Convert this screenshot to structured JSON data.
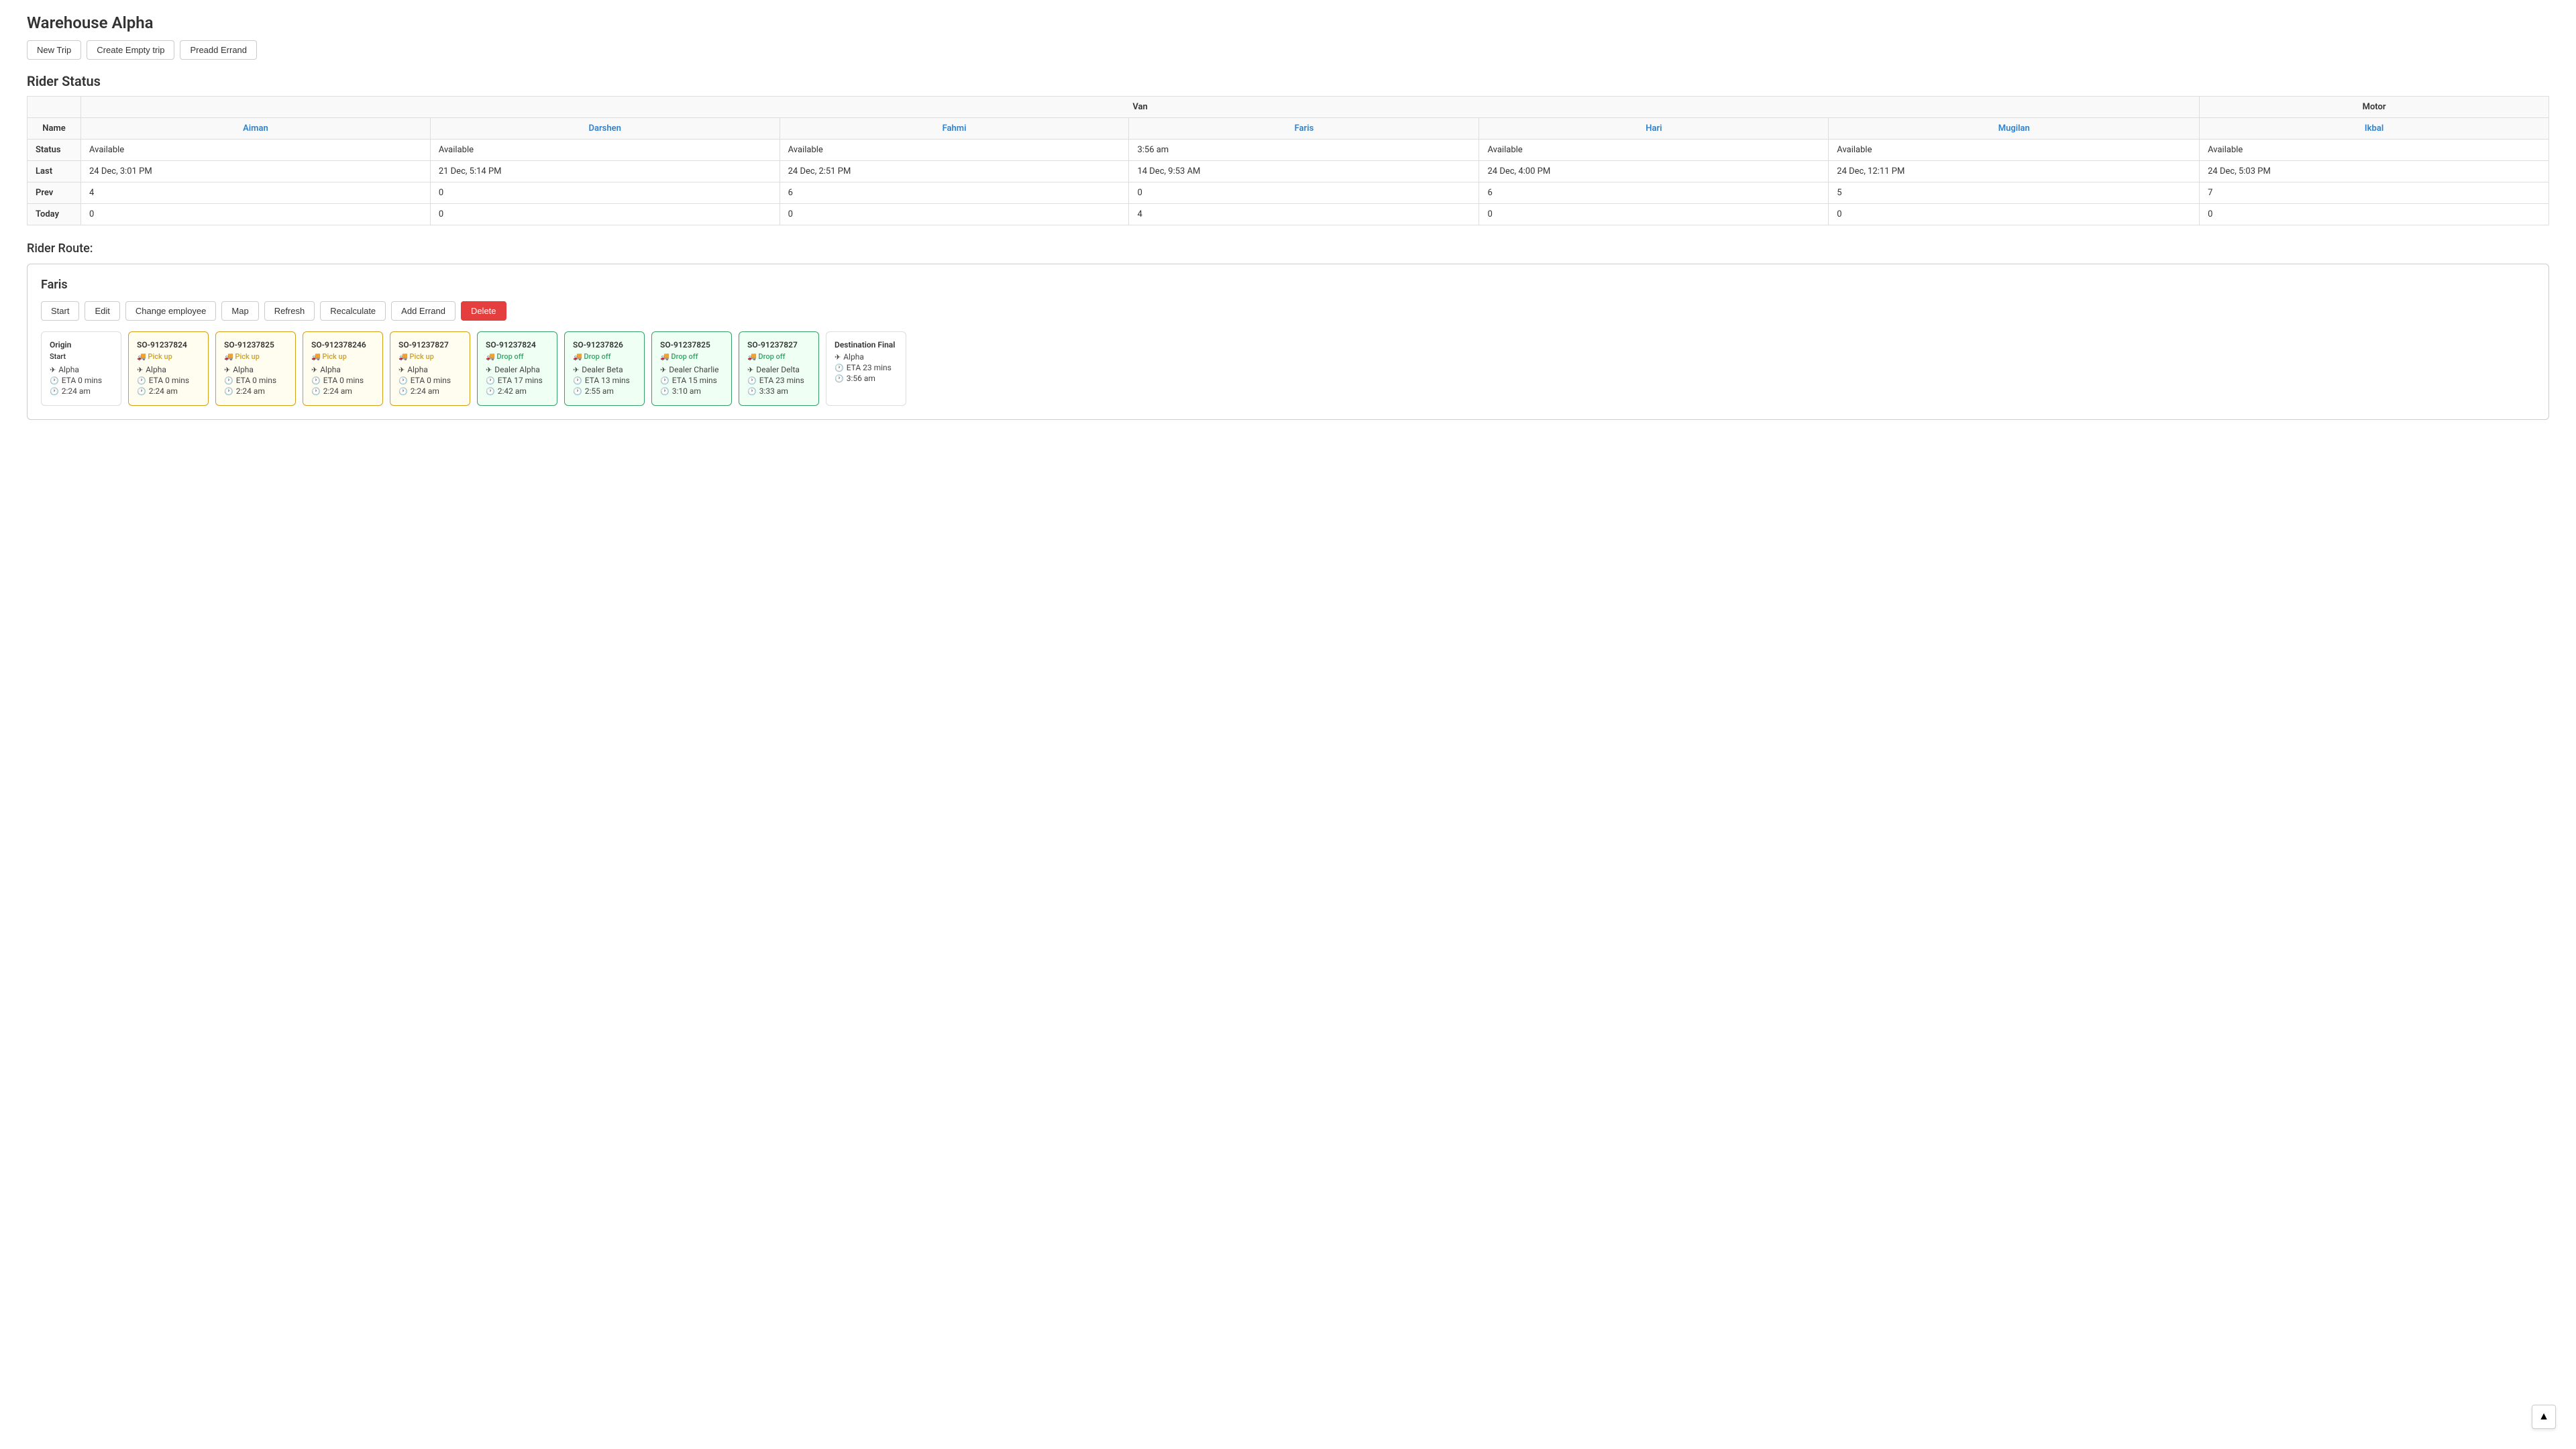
{
  "page": {
    "title": "Warehouse Alpha",
    "toolbar": {
      "new_trip": "New Trip",
      "create_empty_trip": "Create Empty trip",
      "preadd_errand": "Preadd Errand"
    }
  },
  "rider_status": {
    "section_title": "Rider Status",
    "column_groups": [
      {
        "label": "Van",
        "span": 6
      },
      {
        "label": "Motor",
        "span": 1
      }
    ],
    "riders": [
      "Aiman",
      "Darshen",
      "Fahmi",
      "Faris",
      "Hari",
      "Mugilan",
      "Ikbal"
    ],
    "rows": {
      "status": [
        "Available",
        "Available",
        "Available",
        "3:56 am",
        "Available",
        "Available",
        "Available"
      ],
      "last": [
        "24 Dec, 3:01 PM",
        "21 Dec, 5:14 PM",
        "24 Dec, 2:51 PM",
        "14 Dec, 9:53 AM",
        "24 Dec, 4:00 PM",
        "24 Dec, 12:11 PM",
        "24 Dec, 5:03 PM"
      ],
      "prev": [
        "4",
        "0",
        "6",
        "0",
        "6",
        "5",
        "7"
      ],
      "today": [
        "0",
        "0",
        "0",
        "4",
        "0",
        "0",
        "0"
      ]
    }
  },
  "rider_route": {
    "section_title": "Rider Route:",
    "rider_name": "Faris",
    "toolbar": {
      "start": "Start",
      "edit": "Edit",
      "change_employee": "Change employee",
      "map": "Map",
      "refresh": "Refresh",
      "recalculate": "Recalculate",
      "add_errand": "Add Errand",
      "delete": "Delete"
    },
    "cards": [
      {
        "id": "origin",
        "title": "Origin",
        "type": "Start",
        "type_class": "plain",
        "location": "Alpha",
        "eta_mins": "0 mins",
        "eta_time": "2:24 am",
        "border": "plain-border"
      },
      {
        "id": "so1",
        "title": "SO-91237824",
        "type": "🚚 Pick up",
        "type_class": "pickup",
        "location": "Alpha",
        "eta_mins": "0 mins",
        "eta_time": "2:24 am",
        "border": "yellow-border"
      },
      {
        "id": "so2",
        "title": "SO-91237825",
        "type": "🚚 Pick up",
        "type_class": "pickup",
        "location": "Alpha",
        "eta_mins": "0 mins",
        "eta_time": "2:24 am",
        "border": "yellow-border"
      },
      {
        "id": "so3",
        "title": "SO-912378246",
        "type": "🚚 Pick up",
        "type_class": "pickup",
        "location": "Alpha",
        "eta_mins": "0 mins",
        "eta_time": "2:24 am",
        "border": "yellow-border"
      },
      {
        "id": "so4",
        "title": "SO-91237827",
        "type": "🚚 Pick up",
        "type_class": "pickup",
        "location": "Alpha",
        "eta_mins": "0 mins",
        "eta_time": "2:24 am",
        "border": "yellow-border"
      },
      {
        "id": "so5",
        "title": "SO-91237824",
        "type": "🚚 Drop off",
        "type_class": "dropoff",
        "location": "Dealer Alpha",
        "eta_mins": "17 mins",
        "eta_time": "2:42 am",
        "border": "green-border"
      },
      {
        "id": "so6",
        "title": "SO-91237826",
        "type": "🚚 Drop off",
        "type_class": "dropoff",
        "location": "Dealer Beta",
        "eta_mins": "13 mins",
        "eta_time": "2:55 am",
        "border": "green-border"
      },
      {
        "id": "so7",
        "title": "SO-91237825",
        "type": "🚚 Drop off",
        "type_class": "dropoff",
        "location": "Dealer Charlie",
        "eta_mins": "15 mins",
        "eta_time": "3:10 am",
        "border": "green-border"
      },
      {
        "id": "so8",
        "title": "SO-91237827",
        "type": "🚚 Drop off",
        "type_class": "dropoff",
        "location": "Dealer Delta",
        "eta_mins": "23 mins",
        "eta_time": "3:33 am",
        "border": "green-border"
      },
      {
        "id": "destination",
        "title": "Destination Final",
        "type": "",
        "type_class": "plain",
        "location": "Alpha",
        "eta_mins": "23 mins",
        "eta_time": "3:56 am",
        "border": "plain-border"
      }
    ]
  },
  "scroll_top_icon": "▲"
}
